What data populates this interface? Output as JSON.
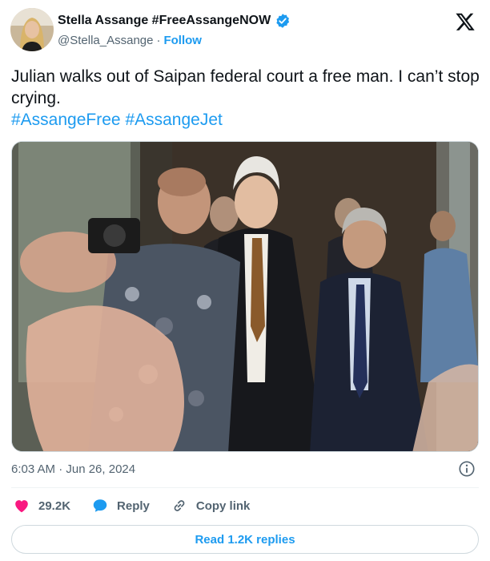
{
  "author": {
    "display_name": "Stella Assange #FreeAssangeNOW",
    "handle": "@Stella_Assange",
    "separator": "·",
    "follow_label": "Follow",
    "verified": true,
    "avatar_icon": "profile-photo"
  },
  "platform_logo": "x-logo-icon",
  "tweet": {
    "text": "Julian walks out of Saipan federal court a free man. I can’t stop crying.",
    "hashtags": [
      "#AssangeFree",
      "#AssangeJet"
    ],
    "photo_icon": "tweet-photo"
  },
  "meta": {
    "timestamp": "6:03 AM · Jun 26, 2024",
    "info_icon": "info-icon"
  },
  "actions": {
    "like_count": "29.2K",
    "reply_label": "Reply",
    "copy_link_label": "Copy link"
  },
  "read_replies_label": "Read 1.2K replies",
  "colors": {
    "accent": "#1d9bf0",
    "like": "#f91880",
    "text": "#0f1419",
    "secondary": "#536471"
  }
}
